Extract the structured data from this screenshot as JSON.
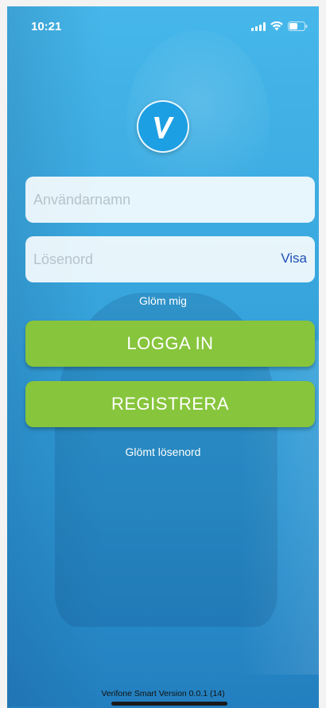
{
  "status_bar": {
    "time": "10:21"
  },
  "icons": {
    "signal": "signal-icon",
    "wifi": "wifi-icon",
    "battery": "battery-icon",
    "logo": "verifone-v-logo"
  },
  "login": {
    "username_placeholder": "Användarnamn",
    "username_value": "",
    "password_placeholder": "Lösenord",
    "password_value": "",
    "show_password_label": "Visa",
    "forget_me_label": "Glöm mig",
    "login_button_label": "LOGGA IN",
    "register_button_label": "REGISTRERA",
    "forgot_password_label": "Glömt lösenord"
  },
  "footer": {
    "version_text": "Verifone Smart Version 0.0.1 (14)"
  },
  "colors": {
    "background": "#3aa9df",
    "button_green": "#87c53c",
    "link_blue": "#1f4fb3",
    "logo_blue": "#1c9fe3"
  }
}
